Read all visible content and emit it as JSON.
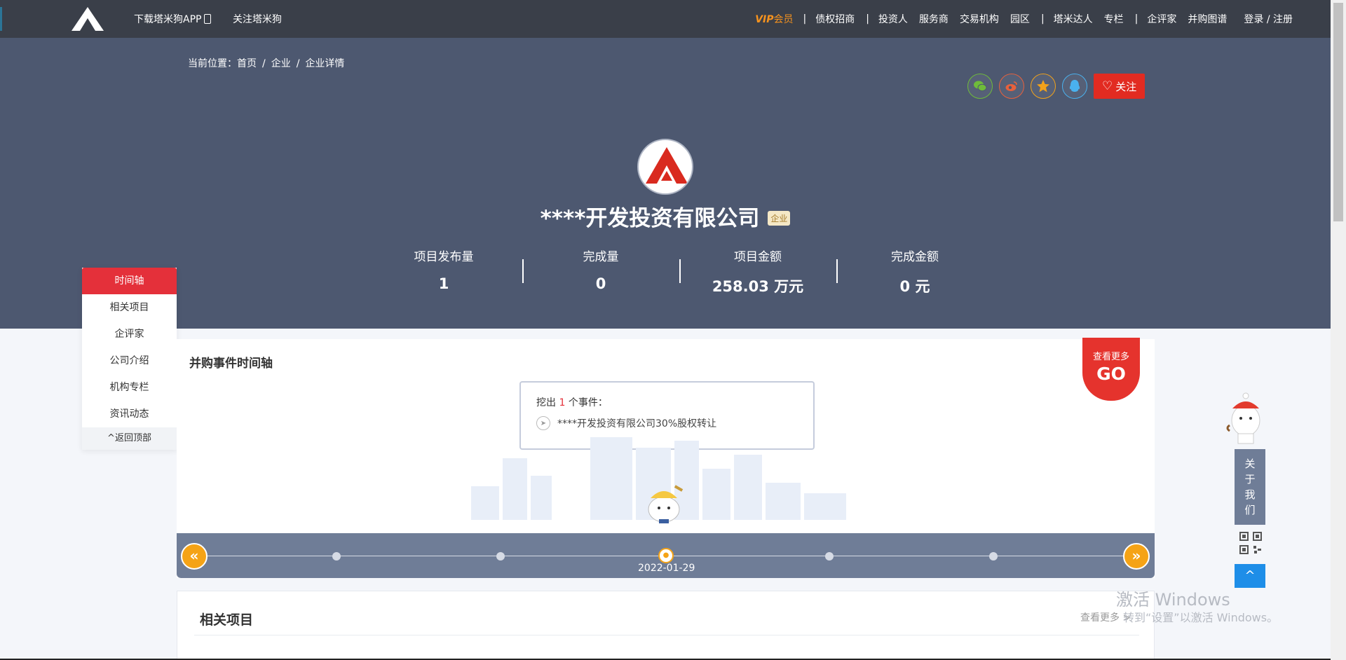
{
  "topbar": {
    "download_app": "下载塔米狗APP",
    "follow": "关注塔米狗",
    "vip": "VIP",
    "vip_suffix": "会员",
    "nav": [
      "债权招商",
      "投资人",
      "服务商",
      "交易机构",
      "园区",
      "塔米达人",
      "专栏",
      "企评家",
      "并购图谱"
    ],
    "login": "登录 / 注册"
  },
  "breadcrumb": {
    "prefix": "当前位置：",
    "items": [
      "首页",
      "企业",
      "企业详情"
    ],
    "separator": "/"
  },
  "share": {
    "icons": [
      "wechat-icon",
      "weibo-icon",
      "star-icon",
      "qq-icon"
    ],
    "follow_label": "关注"
  },
  "company": {
    "name": "****开发投资有限公司",
    "tag": "企业"
  },
  "stats": [
    {
      "label": "项目发布量",
      "value": "1"
    },
    {
      "label": "完成量",
      "value": "0"
    },
    {
      "label": "项目金额",
      "value": "258.03 万元"
    },
    {
      "label": "完成金额",
      "value": "0 元"
    }
  ],
  "sidenav": {
    "items": [
      "时间轴",
      "相关项目",
      "企评家",
      "公司介绍",
      "机构专栏",
      "资讯动态"
    ],
    "back_top": "^返回顶部"
  },
  "timeline": {
    "title": "并购事件时间轴",
    "more_label": "查看更多",
    "go_label": "GO",
    "count_prefix": "挖出",
    "count": "1",
    "count_suffix": "个事件：",
    "event": "****开发投资有限公司30%股权转让",
    "date": "2022-01-29",
    "prev": "«",
    "next": "»"
  },
  "related": {
    "title": "相关项目",
    "more": "查看更多 >"
  },
  "right_widget": {
    "about": [
      "关",
      "于",
      "我",
      "们"
    ],
    "up": "^"
  },
  "watermark": {
    "line1": "激活 Windows",
    "line2": "转到“设置”以激活 Windows。"
  },
  "colors": {
    "topbar": "#3a3f49",
    "banner": "#4d5870",
    "accent_red": "#e4303a",
    "accent_orange": "#f5a316",
    "timeline_bar": "#6f7d97"
  }
}
